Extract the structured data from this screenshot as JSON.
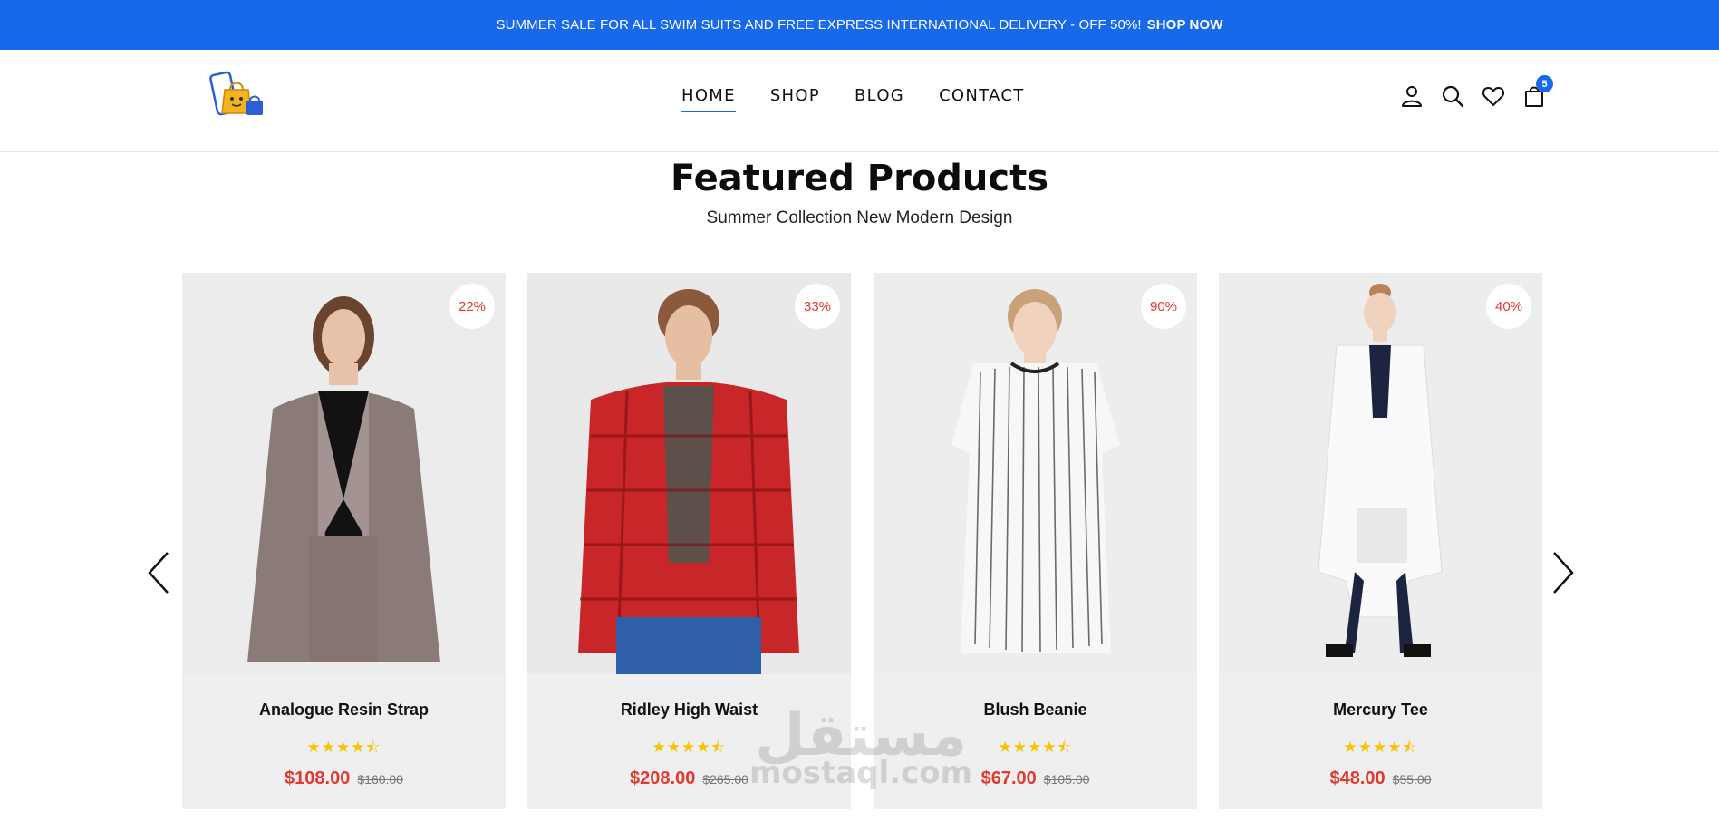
{
  "promo": {
    "text": "SUMMER SALE FOR ALL SWIM SUITS AND FREE EXPRESS INTERNATIONAL DELIVERY - OFF 50%!",
    "cta": "SHOP NOW"
  },
  "header": {
    "logo_icon": "shopping-bag-logo-icon",
    "nav": [
      {
        "label": "HOME",
        "active": true
      },
      {
        "label": "SHOP",
        "active": false
      },
      {
        "label": "BLOG",
        "active": false
      },
      {
        "label": "CONTACT",
        "active": false
      }
    ],
    "icons": [
      "user-icon",
      "search-icon",
      "heart-icon",
      "cart-icon"
    ],
    "cart_count": "5"
  },
  "section": {
    "title": "Featured Products",
    "subtitle": "Summer Collection New Modern Design"
  },
  "carousel": {
    "prev_icon": "chevron-left-icon",
    "next_icon": "chevron-right-icon"
  },
  "products": [
    {
      "name": "Analogue Resin Strap",
      "discount": "22%",
      "stars": "★★★★⯪",
      "rating": 4.5,
      "price": "$108.00",
      "old_price": "$160.00"
    },
    {
      "name": "Ridley High Waist",
      "discount": "33%",
      "stars": "★★★★⯪",
      "rating": 4.5,
      "price": "$208.00",
      "old_price": "$265.00"
    },
    {
      "name": "Blush Beanie",
      "discount": "90%",
      "stars": "★★★★⯪",
      "rating": 4.5,
      "price": "$67.00",
      "old_price": "$105.00"
    },
    {
      "name": "Mercury Tee",
      "discount": "40%",
      "stars": "★★★★⯪",
      "rating": 4.5,
      "price": "$48.00",
      "old_price": "$55.00"
    }
  ],
  "watermark": {
    "arabic": "مستقل",
    "latin": "mostaql.com"
  },
  "colors": {
    "accent": "#1769e9",
    "price": "#e03a2e",
    "star": "#f5c400",
    "card_bg": "#efefef"
  }
}
